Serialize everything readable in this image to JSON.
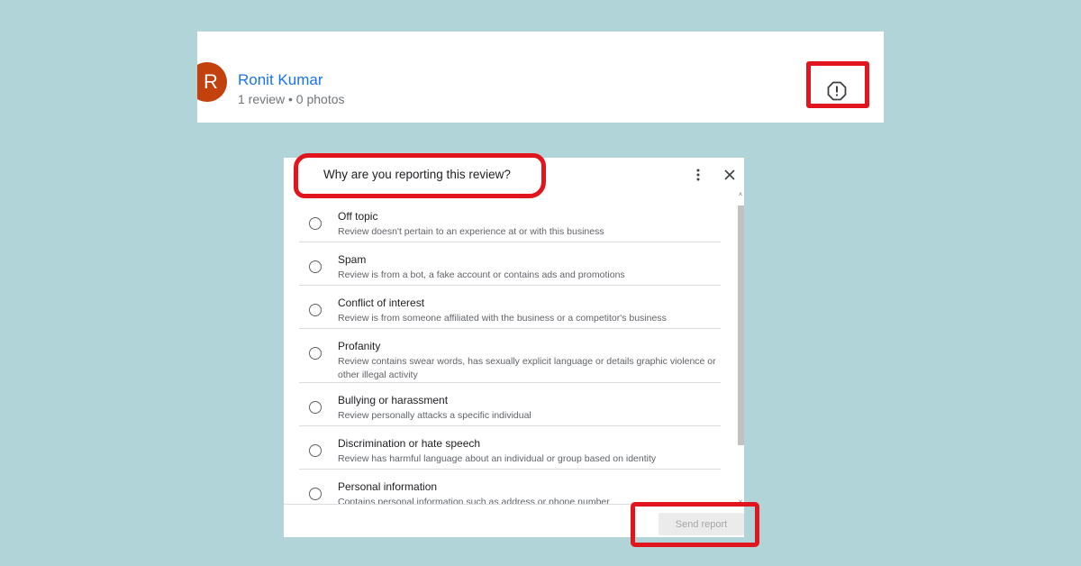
{
  "reviewer": {
    "avatar_letter": "R",
    "name": "Ronit Kumar",
    "meta": "1 review • 0 photos",
    "flag_icon": "report-flag-icon"
  },
  "dialog": {
    "title": "Why are you reporting this review?",
    "more_icon": "more-vert-icon",
    "close_icon": "close-icon",
    "options": [
      {
        "title": "Off topic",
        "description": "Review doesn't pertain to an experience at or with this business"
      },
      {
        "title": "Spam",
        "description": "Review is from a bot, a fake account or contains ads and promotions"
      },
      {
        "title": "Conflict of interest",
        "description": "Review is from someone affiliated with the business or a competitor's business"
      },
      {
        "title": "Profanity",
        "description": "Review contains swear words, has sexually explicit language or details graphic violence or other illegal activity"
      },
      {
        "title": "Bullying or harassment",
        "description": "Review personally attacks a specific individual"
      },
      {
        "title": "Discrimination or hate speech",
        "description": "Review has harmful language about an individual or group based on identity"
      },
      {
        "title": "Personal information",
        "description": "Contains personal information such as address or phone number"
      }
    ],
    "send_label": "Send report"
  },
  "colors": {
    "background": "#b0d4d8",
    "avatar": "#c2410c",
    "link_name": "#1a73e8",
    "highlight": "#e0151d",
    "button_disabled_bg": "#ebebeb",
    "button_disabled_text": "#a6a6a6"
  }
}
